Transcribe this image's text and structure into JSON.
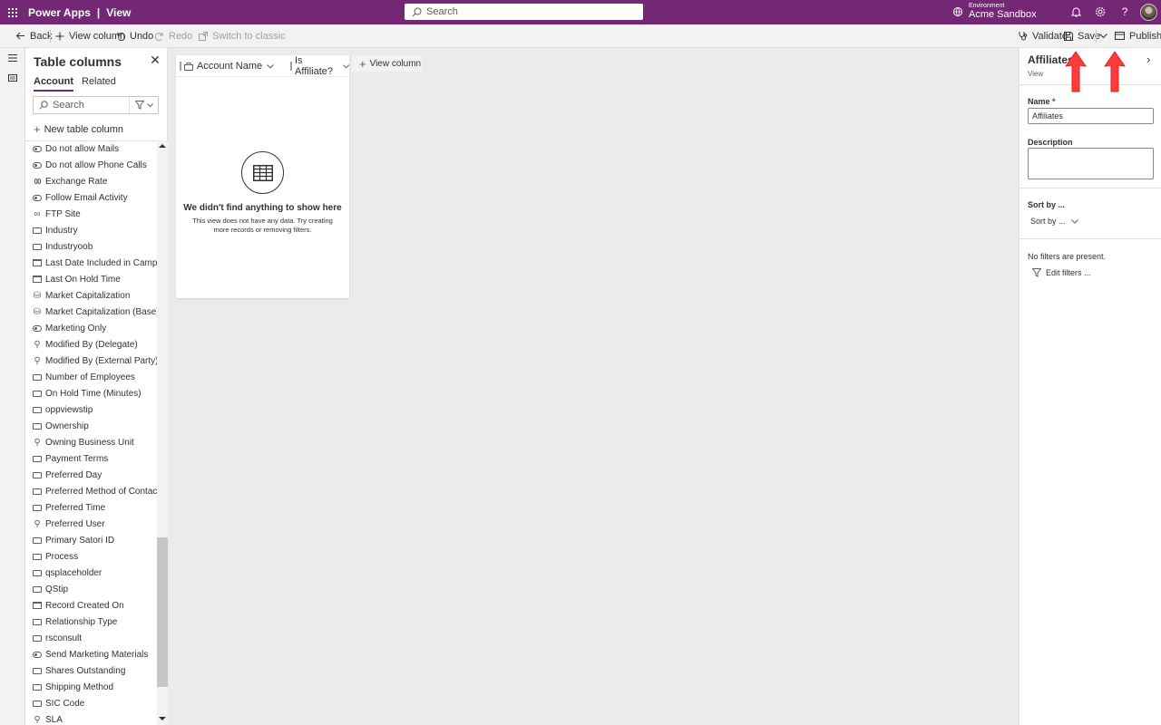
{
  "topbar": {
    "app_name": "Power Apps",
    "separator": "|",
    "section": "View",
    "search_placeholder": "Search",
    "environment_label": "Environment",
    "environment_name": "Acme Sandbox"
  },
  "commandbar": {
    "back": "Back",
    "view_column": "View column",
    "undo": "Undo",
    "redo": "Redo",
    "switch_classic": "Switch to classic",
    "validate": "Validate",
    "save": "Save",
    "publish": "Publish"
  },
  "column_panel": {
    "title": "Table columns",
    "tabs": [
      "Account",
      "Related"
    ],
    "search_placeholder": "Search",
    "new_column": "New table column",
    "items": [
      {
        "label": "Do not allow Mails",
        "icon": "toggle"
      },
      {
        "label": "Do not allow Phone Calls",
        "icon": "toggle"
      },
      {
        "label": "Exchange Rate",
        "icon": "number"
      },
      {
        "label": "Follow Email Activity",
        "icon": "toggle"
      },
      {
        "label": "FTP Site",
        "icon": "link"
      },
      {
        "label": "Industry",
        "icon": "text"
      },
      {
        "label": "Industryoob",
        "icon": "text"
      },
      {
        "label": "Last Date Included in Campaign",
        "icon": "date"
      },
      {
        "label": "Last On Hold Time",
        "icon": "date"
      },
      {
        "label": "Market Capitalization",
        "icon": "currency"
      },
      {
        "label": "Market Capitalization (Base)",
        "icon": "currency"
      },
      {
        "label": "Marketing Only",
        "icon": "toggle"
      },
      {
        "label": "Modified By (Delegate)",
        "icon": "lookup"
      },
      {
        "label": "Modified By (External Party)",
        "icon": "lookup"
      },
      {
        "label": "Number of Employees",
        "icon": "text"
      },
      {
        "label": "On Hold Time (Minutes)",
        "icon": "text"
      },
      {
        "label": "oppviewstip",
        "icon": "text"
      },
      {
        "label": "Ownership",
        "icon": "text"
      },
      {
        "label": "Owning Business Unit",
        "icon": "lookup"
      },
      {
        "label": "Payment Terms",
        "icon": "text"
      },
      {
        "label": "Preferred Day",
        "icon": "text"
      },
      {
        "label": "Preferred Method of Contact",
        "icon": "text"
      },
      {
        "label": "Preferred Time",
        "icon": "text"
      },
      {
        "label": "Preferred User",
        "icon": "lookup"
      },
      {
        "label": "Primary Satori ID",
        "icon": "text"
      },
      {
        "label": "Process",
        "icon": "text"
      },
      {
        "label": "qsplaceholder",
        "icon": "text"
      },
      {
        "label": "QStip",
        "icon": "text"
      },
      {
        "label": "Record Created On",
        "icon": "date"
      },
      {
        "label": "Relationship Type",
        "icon": "text"
      },
      {
        "label": "rsconsult",
        "icon": "text"
      },
      {
        "label": "Send Marketing Materials",
        "icon": "toggle"
      },
      {
        "label": "Shares Outstanding",
        "icon": "text"
      },
      {
        "label": "Shipping Method",
        "icon": "text"
      },
      {
        "label": "SIC Code",
        "icon": "text"
      },
      {
        "label": "SLA",
        "icon": "lookup"
      }
    ]
  },
  "grid": {
    "columns": [
      "Account Name",
      "Is Affiliate?"
    ],
    "empty_title": "We didn't find anything to show here",
    "empty_message": "This view does not have any data. Try creating more records or removing filters.",
    "add_view_column": "View column"
  },
  "properties": {
    "title": "Affiliates",
    "subtitle": "View",
    "name_label": "Name",
    "required_mark": "*",
    "name_value": "Affiliates",
    "description_label": "Description",
    "description_value": "",
    "sort_label": "Sort by ...",
    "sort_button": "Sort by ...",
    "no_filters": "No filters are present.",
    "edit_filters": "Edit filters ..."
  },
  "colors": {
    "brand": "#742774",
    "annotation_arrow": "#ff3b3b"
  }
}
